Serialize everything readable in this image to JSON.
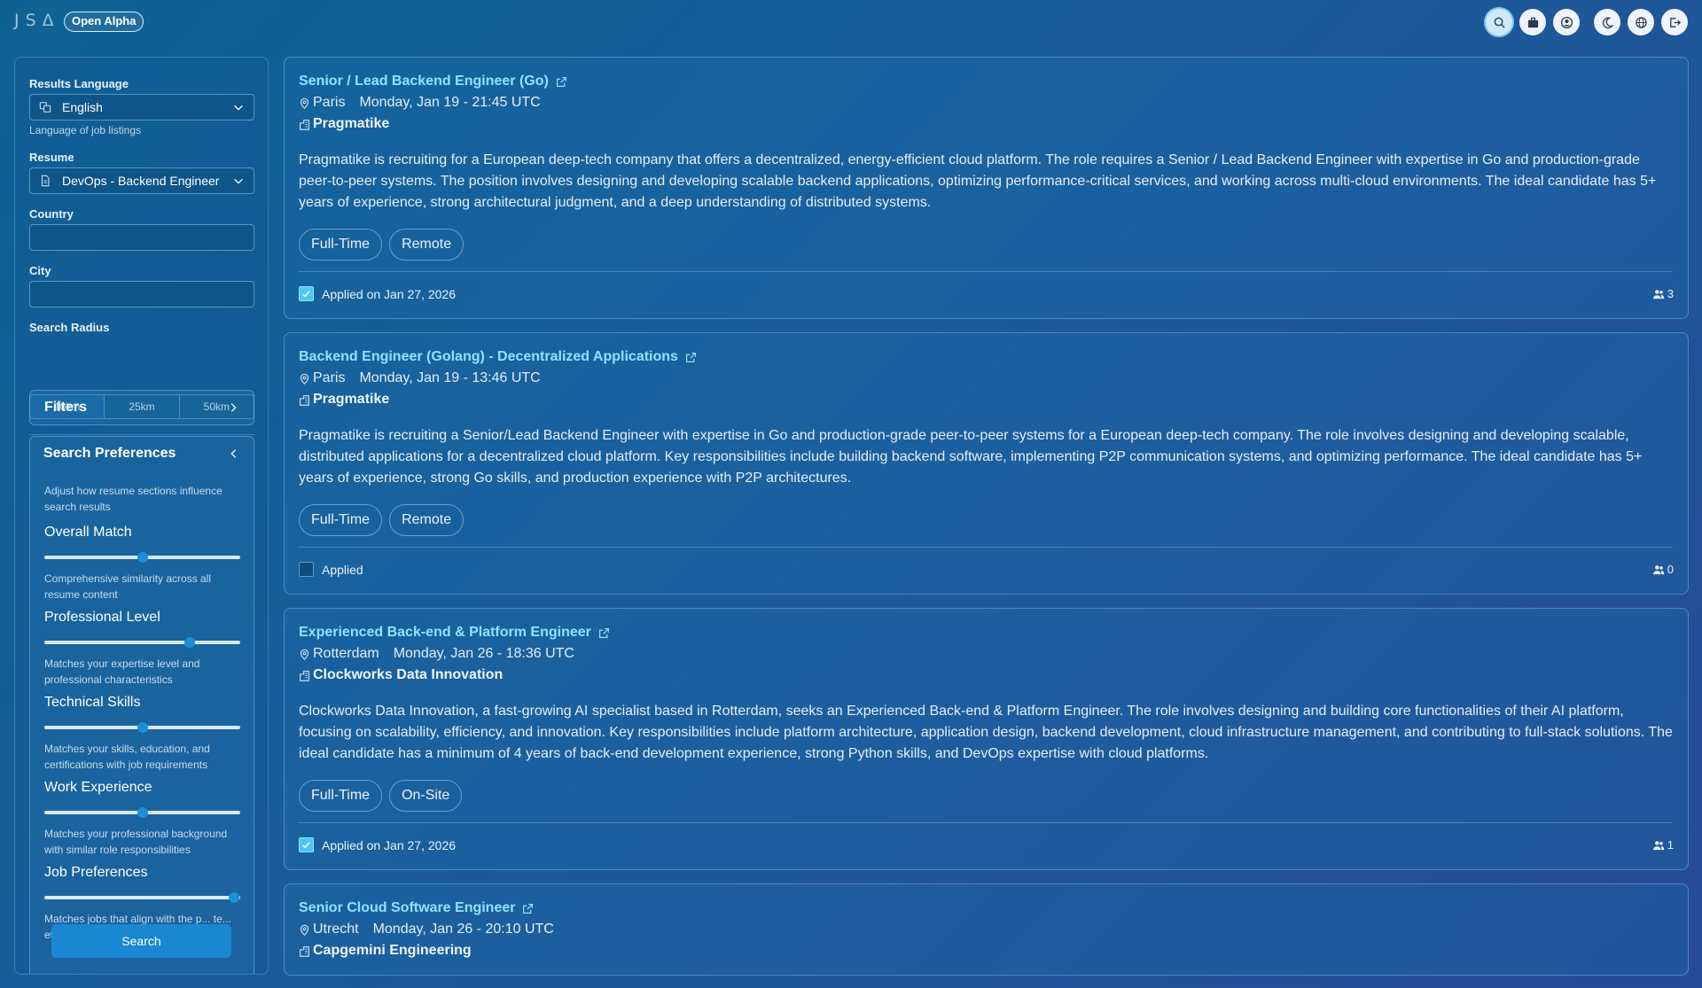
{
  "app": {
    "logo_letters": [
      "J",
      "S",
      "Δ"
    ],
    "badge": "Open Alpha",
    "top_icons": [
      "search-icon",
      "briefcase-icon",
      "user-icon",
      "moon-icon",
      "globe-icon",
      "logout-icon"
    ]
  },
  "sidebar": {
    "results_language": {
      "label": "Results Language",
      "value": "English",
      "help": "Language of job listings"
    },
    "resume": {
      "label": "Resume",
      "value": "DevOps - Backend Engineer"
    },
    "country": {
      "label": "Country",
      "value": ""
    },
    "city": {
      "label": "City",
      "value": ""
    },
    "radius": {
      "label": "Search Radius",
      "options": [
        "10km",
        "25km",
        "50km"
      ],
      "selected": "10km"
    },
    "filters_label": "Filters",
    "preferences": {
      "title": "Search Preferences",
      "intro": "Adjust how resume sections influence search results",
      "items": [
        {
          "title": "Overall Match",
          "value": 0.5,
          "desc": "Comprehensive similarity across all resume content"
        },
        {
          "title": "Professional Level",
          "value": 0.74,
          "desc": "Matches your expertise level and professional characteristics"
        },
        {
          "title": "Technical Skills",
          "value": 0.5,
          "desc": "Matches your skills, education, and certifications with job requirements"
        },
        {
          "title": "Work Experience",
          "value": 0.5,
          "desc": "Matches your professional background with similar role responsibilities"
        },
        {
          "title": "Job Preferences",
          "value": 0.97,
          "desc": "Matches jobs that align with the p... te... etc.)"
        }
      ]
    },
    "search_button": "Search"
  },
  "jobs": [
    {
      "title": "Senior / Lead Backend Engineer (Go)",
      "location": "Paris",
      "date": "Monday, Jan 19 - 21:45 UTC",
      "company": "Pragmatike",
      "description": "Pragmatike is recruiting for a European deep-tech company that offers a decentralized, energy-efficient cloud platform. The role requires a Senior / Lead Backend Engineer with expertise in Go and production-grade peer-to-peer systems. The position involves designing and developing scalable backend applications, optimizing performance-critical services, and working across multi-cloud environments. The ideal candidate has 5+ years of experience, strong architectural judgment, and a deep understanding of distributed systems.",
      "tags": [
        "Full-Time",
        "Remote"
      ],
      "applied": true,
      "applied_text": "Applied on Jan 27, 2026",
      "viewers": "3"
    },
    {
      "title": "Backend Engineer (Golang) - Decentralized Applications",
      "location": "Paris",
      "date": "Monday, Jan 19 - 13:46 UTC",
      "company": "Pragmatike",
      "description": "Pragmatike is recruiting a Senior/Lead Backend Engineer with expertise in Go and production-grade peer-to-peer systems for a European deep-tech company. The role involves designing and developing scalable, distributed applications for a decentralized cloud platform. Key responsibilities include building backend software, implementing P2P communication systems, and optimizing performance. The ideal candidate has 5+ years of experience, strong Go skills, and production experience with P2P architectures.",
      "tags": [
        "Full-Time",
        "Remote"
      ],
      "applied": false,
      "applied_text": "Applied",
      "viewers": "0"
    },
    {
      "title": "Experienced Back-end & Platform Engineer",
      "location": "Rotterdam",
      "date": "Monday, Jan 26 - 18:36 UTC",
      "company": "Clockworks Data Innovation",
      "description": "Clockworks Data Innovation, a fast-growing AI specialist based in Rotterdam, seeks an Experienced Back-end & Platform Engineer. The role involves designing and building core functionalities of their AI platform, focusing on scalability, efficiency, and innovation. Key responsibilities include platform architecture, application design, backend development, cloud infrastructure management, and contributing to full-stack solutions. The ideal candidate has a minimum of 4 years of back-end development experience, strong Python skills, and DevOps expertise with cloud platforms.",
      "tags": [
        "Full-Time",
        "On-Site"
      ],
      "applied": true,
      "applied_text": "Applied on Jan 27, 2026",
      "viewers": "1"
    },
    {
      "title": "Senior Cloud Software Engineer",
      "location": "Utrecht",
      "date": "Monday, Jan 26 - 20:10 UTC",
      "company": "Capgemini Engineering",
      "description": "",
      "tags": [],
      "applied": false,
      "applied_text": "",
      "viewers": ""
    }
  ]
}
